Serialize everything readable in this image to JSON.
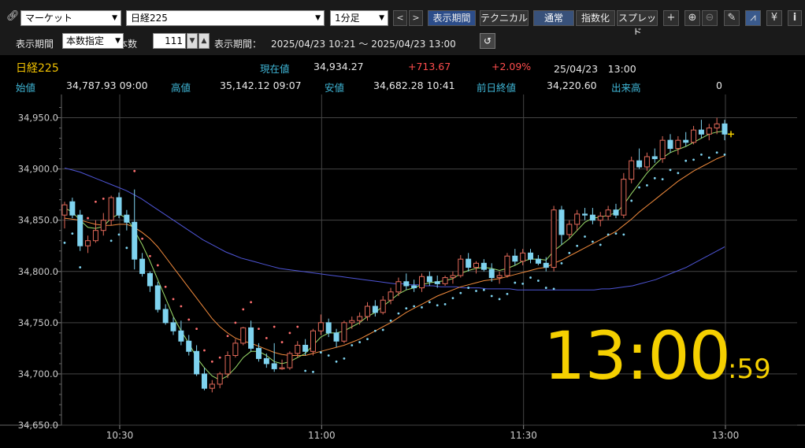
{
  "toolbar": {
    "market_select": "マーケット",
    "symbol_select": "日経225",
    "interval_select": "1分足",
    "prev_label": "<",
    "next_label": ">",
    "period_label": "表示期間",
    "technical_label": "テクニカル",
    "normal_label": "通常",
    "index_label": "指数化",
    "spread_label": "スプレッド",
    "plus_label": "+",
    "yen_label": "¥",
    "info_label": "i"
  },
  "period_bar": {
    "period_caption": "表示期間",
    "period_mode": "本数指定",
    "count_caption": "本数",
    "count_value": "111",
    "range_caption": "表示期間：",
    "range_value": "2025/04/23 10:21 ～ 2025/04/23 13:00"
  },
  "quote": {
    "name": "日経225",
    "current_label": "現在値",
    "current_value": "34,934.27",
    "change": "+713.67",
    "change_pct": "+2.09%",
    "datetime": "25/04/23　13:00",
    "open_label": "始値",
    "open_value": "34,787.93 09:00",
    "high_label": "高値",
    "high_value": "35,142.12 09:07",
    "low_label": "安値",
    "low_value": "34,682.28 10:41",
    "prev_close_label": "前日終値",
    "prev_close_value": "34,220.60",
    "volume_label": "出来高",
    "volume_value": "0"
  },
  "clock": {
    "time": "13:00",
    "seconds": ":59"
  },
  "colors": {
    "up": "#e36a5a",
    "down": "#7fd3ef",
    "ma_short": "#9bdc6a",
    "ma_mid": "#f08a3c",
    "ma_long": "#4e55d6",
    "sar_above": "#ff6f6f",
    "sar_below": "#7fd3ef"
  },
  "chart_data": {
    "type": "candlestick",
    "y_ticks": [
      "34,950.0",
      "34,900.0",
      "34,850.0",
      "34,800.0",
      "34,750.0",
      "34,700.0",
      "34,650.0"
    ],
    "x_ticks": [
      "10:30",
      "11:00",
      "11:30",
      "13:00"
    ],
    "ylim": [
      34650,
      34965
    ],
    "grid": true,
    "candles": [
      [
        34855,
        34868,
        34842,
        34865
      ],
      [
        34868,
        34872,
        34852,
        34855
      ],
      [
        34855,
        34860,
        34820,
        34825
      ],
      [
        34825,
        34835,
        34818,
        34830
      ],
      [
        34830,
        34850,
        34828,
        34840
      ],
      [
        34840,
        34857,
        34835,
        34850
      ],
      [
        34850,
        34874,
        34845,
        34872
      ],
      [
        34872,
        34877,
        34852,
        34855
      ],
      [
        34855,
        34860,
        34840,
        34848
      ],
      [
        34848,
        34880,
        34802,
        34812
      ],
      [
        34812,
        34818,
        34795,
        34798
      ],
      [
        34798,
        34800,
        34780,
        34786
      ],
      [
        34786,
        34790,
        34760,
        34763
      ],
      [
        34763,
        34768,
        34748,
        34750
      ],
      [
        34750,
        34755,
        34738,
        34742
      ],
      [
        34742,
        34752,
        34728,
        34732
      ],
      [
        34732,
        34738,
        34718,
        34722
      ],
      [
        34722,
        34728,
        34698,
        34700
      ],
      [
        34700,
        34706,
        34684,
        34686
      ],
      [
        34686,
        34694,
        34682,
        34690
      ],
      [
        34690,
        34702,
        34686,
        34700
      ],
      [
        34700,
        34722,
        34696,
        34718
      ],
      [
        34718,
        34734,
        34716,
        34730
      ],
      [
        34730,
        34746,
        34728,
        34745
      ],
      [
        34745,
        34752,
        34722,
        34725
      ],
      [
        34725,
        34730,
        34712,
        34715
      ],
      [
        34715,
        34720,
        34706,
        34710
      ],
      [
        34710,
        34730,
        34702,
        34705
      ],
      [
        34705,
        34714,
        34704,
        34706
      ],
      [
        34706,
        34722,
        34704,
        34720
      ],
      [
        34720,
        34732,
        34716,
        34728
      ],
      [
        34728,
        34734,
        34718,
        34722
      ],
      [
        34722,
        34744,
        34718,
        34742
      ],
      [
        34742,
        34758,
        34738,
        34750
      ],
      [
        34750,
        34754,
        34736,
        34740
      ],
      [
        34740,
        34744,
        34726,
        34732
      ],
      [
        34732,
        34752,
        34730,
        34750
      ],
      [
        34750,
        34756,
        34744,
        34752
      ],
      [
        34752,
        34760,
        34748,
        34756
      ],
      [
        34756,
        34770,
        34752,
        34766
      ],
      [
        34766,
        34772,
        34756,
        34760
      ],
      [
        34760,
        34776,
        34758,
        34772
      ],
      [
        34772,
        34784,
        34768,
        34780
      ],
      [
        34780,
        34794,
        34776,
        34790
      ],
      [
        34790,
        34798,
        34782,
        34786
      ],
      [
        34786,
        34792,
        34780,
        34784
      ],
      [
        34784,
        34798,
        34780,
        34795
      ],
      [
        34795,
        34800,
        34786,
        34790
      ],
      [
        34790,
        34796,
        34784,
        34788
      ],
      [
        34788,
        34796,
        34786,
        34794
      ],
      [
        34794,
        34800,
        34788,
        34796
      ],
      [
        34796,
        34816,
        34794,
        34812
      ],
      [
        34812,
        34818,
        34800,
        34804
      ],
      [
        34804,
        34810,
        34798,
        34808
      ],
      [
        34808,
        34812,
        34800,
        34802
      ],
      [
        34802,
        34808,
        34790,
        34794
      ],
      [
        34794,
        34800,
        34788,
        34796
      ],
      [
        34796,
        34818,
        34794,
        34815
      ],
      [
        34815,
        34822,
        34806,
        34810
      ],
      [
        34810,
        34822,
        34806,
        34818
      ],
      [
        34818,
        34822,
        34808,
        34812
      ],
      [
        34812,
        34816,
        34806,
        34808
      ],
      [
        34808,
        34814,
        34800,
        34804
      ],
      [
        34804,
        34864,
        34800,
        34860
      ],
      [
        34860,
        34864,
        34826,
        34836
      ],
      [
        34836,
        34850,
        34832,
        34846
      ],
      [
        34846,
        34860,
        34840,
        34856
      ],
      [
        34856,
        34862,
        34850,
        34855
      ],
      [
        34855,
        34862,
        34846,
        34850
      ],
      [
        34850,
        34858,
        34844,
        34854
      ],
      [
        34854,
        34864,
        34850,
        34860
      ],
      [
        34860,
        34866,
        34852,
        34855
      ],
      [
        34855,
        34896,
        34852,
        34890
      ],
      [
        34890,
        34912,
        34886,
        34908
      ],
      [
        34908,
        34920,
        34900,
        34902
      ],
      [
        34902,
        34916,
        34898,
        34912
      ],
      [
        34912,
        34920,
        34906,
        34910
      ],
      [
        34910,
        34932,
        34906,
        34928
      ],
      [
        34928,
        34934,
        34916,
        34920
      ],
      [
        34920,
        34932,
        34914,
        34928
      ],
      [
        34928,
        34936,
        34922,
        34926
      ],
      [
        34926,
        34942,
        34924,
        34938
      ],
      [
        34938,
        34948,
        34930,
        34934
      ],
      [
        34934,
        34944,
        34928,
        34940
      ],
      [
        34940,
        34950,
        34934,
        34944
      ],
      [
        34944,
        34948,
        34928,
        34934
      ]
    ],
    "ma_short": [
      34862,
      34858,
      34850,
      34843,
      34842,
      34844,
      34852,
      34856,
      34852,
      34840,
      34826,
      34810,
      34792,
      34774,
      34756,
      34742,
      34730,
      34716,
      34706,
      34698,
      34694,
      34698,
      34706,
      34716,
      34722,
      34722,
      34718,
      34712,
      34710,
      34712,
      34716,
      34720,
      34728,
      34736,
      34740,
      34740,
      34742,
      34746,
      34750,
      34756,
      34760,
      34766,
      34772,
      34778,
      34782,
      34784,
      34787,
      34789,
      34790,
      34791,
      34793,
      34798,
      34801,
      34803,
      34804,
      34803,
      34801,
      34803,
      34806,
      34810,
      34812,
      34812,
      34811,
      34820,
      34826,
      34832,
      34840,
      34848,
      34852,
      34853,
      34855,
      34857,
      34865,
      34876,
      34886,
      34896,
      34904,
      34911,
      34916,
      34919,
      34922,
      34926,
      34930,
      34934,
      34936,
      34937
    ],
    "ma_mid": [
      34852,
      34851,
      34850,
      34848,
      34846,
      34845,
      34845,
      34846,
      34846,
      34843,
      34838,
      34832,
      34824,
      34814,
      34804,
      34794,
      34784,
      34774,
      34764,
      34754,
      34746,
      34740,
      34735,
      34732,
      34730,
      34727,
      34724,
      34721,
      34719,
      34718,
      34718,
      34718,
      34720,
      34722,
      34724,
      34726,
      34728,
      34731,
      34734,
      34738,
      34742,
      34746,
      34750,
      34755,
      34760,
      34764,
      34768,
      34772,
      34776,
      34779,
      34782,
      34785,
      34787,
      34789,
      34791,
      34792,
      34793,
      34795,
      34797,
      34799,
      34801,
      34803,
      34804,
      34808,
      34811,
      34815,
      34819,
      34823,
      34827,
      34831,
      34835,
      34839,
      34845,
      34851,
      34858,
      34864,
      34870,
      34876,
      34882,
      34888,
      34893,
      34898,
      34902,
      34906,
      34910,
      34913
    ],
    "ma_long": [
      34901,
      34899,
      34897,
      34894,
      34891,
      34888,
      34885,
      34882,
      34879,
      34875,
      34871,
      34866,
      34861,
      34856,
      34851,
      34846,
      34841,
      34836,
      34831,
      34827,
      34823,
      34819,
      34816,
      34813,
      34811,
      34809,
      34807,
      34805,
      34803,
      34802,
      34801,
      34800,
      34799,
      34798,
      34797,
      34796,
      34795,
      34794,
      34793,
      34792,
      34791,
      34790,
      34789,
      34788,
      34788,
      34787,
      34787,
      34786,
      34786,
      34785,
      34785,
      34785,
      34784,
      34784,
      34784,
      34783,
      34783,
      34783,
      34783,
      34782,
      34782,
      34782,
      34782,
      34782,
      34782,
      34782,
      34782,
      34782,
      34782,
      34782,
      34783,
      34783,
      34784,
      34785,
      34786,
      34788,
      34790,
      34792,
      34795,
      34798,
      34801,
      34804,
      34808,
      34812,
      34816,
      34820,
      34824
    ]
  }
}
